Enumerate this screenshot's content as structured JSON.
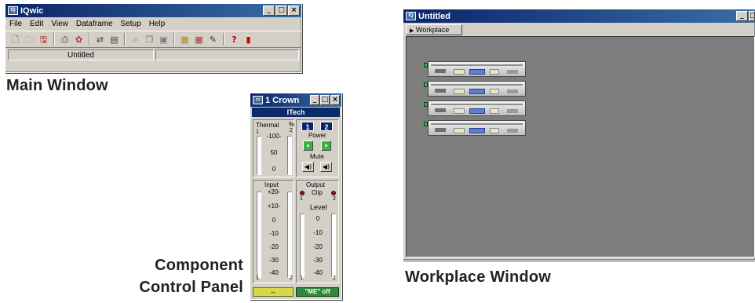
{
  "main_window": {
    "title": "IQwic",
    "menu": [
      "File",
      "Edit",
      "View",
      "Dataframe",
      "Setup",
      "Help"
    ],
    "status": "Untitled",
    "toolbar_icons": [
      "new-icon",
      "open-icon",
      "save-icon",
      "print-icon",
      "setup-icon",
      "network-icon",
      "transfer-icon",
      "find-icon",
      "copy-icon",
      "paste-icon",
      "device-icon",
      "group-icon",
      "edit-icon",
      "help-icon",
      "exit-icon"
    ]
  },
  "captions": {
    "main": "Main Window",
    "component_line1": "Component",
    "component_line2": "Control Panel",
    "workplace": "Workplace Window"
  },
  "component_panel": {
    "title": "1 Crown",
    "name": "ITech",
    "thermal": "Thermal",
    "percent": "%",
    "ch1": "1",
    "ch2": "2",
    "power": "Power",
    "mute": "Mute",
    "thermal_scale": [
      "-100-",
      "50",
      "0"
    ],
    "input": "Input",
    "output": "Output",
    "clip": "Clip",
    "level": "Level",
    "input_scale": [
      "+20-",
      "+10-",
      "0",
      "-10",
      "-20",
      "-30",
      "-40"
    ],
    "output_scale": [
      "0",
      "-10",
      "-20",
      "-30",
      "-40"
    ],
    "one": "1",
    "two": "2",
    "bottom_left": "↔",
    "bottom_right": "\"ME\" off"
  },
  "workplace_window": {
    "title": "Untitled",
    "button": "Workplace",
    "amp_count": 4
  }
}
